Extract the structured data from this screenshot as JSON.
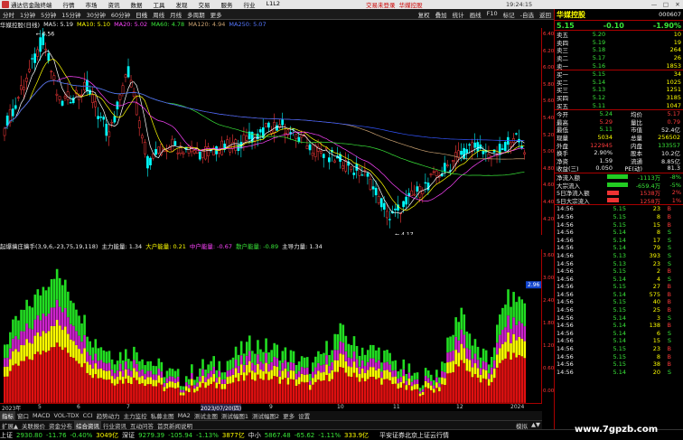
{
  "titlebar": {
    "app": "通达信金融终端",
    "menu": [
      "行情",
      "市场",
      "资讯",
      "数据",
      "工具",
      "发现",
      "交易",
      "服务",
      "行业",
      "L1L2"
    ],
    "promo_login": "交易未登录",
    "promo_stock": "华媒控股",
    "clock": "19:24:15",
    "winbtns": [
      "—",
      "□",
      "✕"
    ]
  },
  "toolbar": {
    "timeframes": [
      "分时",
      "1分钟",
      "5分钟",
      "15分钟",
      "30分钟",
      "60分钟",
      "日线",
      "周线",
      "月线",
      "多周期",
      "更多"
    ],
    "active": "日线",
    "right": [
      "复权",
      "叠加",
      "统计",
      "画线",
      "F10",
      "标记",
      "-自选",
      "返回"
    ]
  },
  "kline_head": {
    "name": "华媒控股(日线)",
    "ma5": "MA5: 5.19",
    "ma10": "MA10: 5.10",
    "ma20": "MA20: 5.02",
    "ma60": "MA60: 4.78",
    "ma120": "MA120: 4.94",
    "ma250": "MA250: 5.07"
  },
  "kline_labels": {
    "high": "6.56",
    "low": "4.17"
  },
  "ind_head": {
    "name": "起爆擒庄擒手(3,9,6,-23,75,19,118)",
    "main": "主力能量: 1.34",
    "large": "大户能量: 0.21",
    "mid": "中户能量: -0.67",
    "retail": "散户能量: -0.89",
    "main2": "主导力量: 1.34"
  },
  "ind_labels": {
    "current": "2.96",
    "lbl1": "散户",
    "lbl2": "中户",
    "lbl3": "大户",
    "lbl4": "主力"
  },
  "kline_yaxis": [
    "6.40",
    "6.20",
    "6.00",
    "5.80",
    "5.60",
    "5.40",
    "5.20",
    "5.00",
    "4.80",
    "4.60",
    "4.40",
    "4.20"
  ],
  "ind_yaxis": [
    "3.60",
    "3.00",
    "2.40",
    "1.80",
    "1.20",
    "0.60",
    "0.00"
  ],
  "xaxis": [
    "2023年",
    "5",
    "6",
    "7",
    "2023/07/20(四)",
    "9",
    "10",
    "11",
    "12",
    "2024"
  ],
  "ind_tabs": [
    "指标",
    "窗口",
    "MACD",
    "VOL-TDX",
    "CCI",
    "趋势动力",
    "主力监控",
    "私募主图",
    "MA2",
    "测试主图",
    "测试幅图1",
    "测试幅图2",
    "更多",
    "设置"
  ],
  "ind_tab_active": "指标",
  "bottom_tabs": [
    "扩展▲",
    "关联报价",
    "资金分布",
    "综合资讯",
    "行业资讯",
    "互动问答",
    "首页新闻说明"
  ],
  "bottom_right": [
    "模拟",
    "▲▼"
  ],
  "rp": {
    "name": "华媒控股",
    "code": "000607",
    "price": "5.15",
    "chg": "-0.10",
    "pct": "-1.90%",
    "asks": [
      [
        "卖五",
        "5.20",
        "10"
      ],
      [
        "卖四",
        "5.19",
        "19"
      ],
      [
        "卖三",
        "5.18",
        "264"
      ],
      [
        "卖二",
        "5.17",
        "26"
      ],
      [
        "卖一",
        "5.16",
        "1853"
      ]
    ],
    "bids": [
      [
        "买一",
        "5.15",
        "34"
      ],
      [
        "买二",
        "5.14",
        "1025"
      ],
      [
        "买三",
        "5.13",
        "1251"
      ],
      [
        "买四",
        "5.12",
        "3185"
      ],
      [
        "买五",
        "5.11",
        "1047"
      ]
    ],
    "stats": [
      [
        "今开",
        "5.24",
        "均价",
        "5.17"
      ],
      [
        "最高",
        "5.29",
        "量比",
        "0.79"
      ],
      [
        "最低",
        "5.11",
        "市值",
        "52.4亿"
      ],
      [
        "现量",
        "5034",
        "总量",
        "256502"
      ],
      [
        "外盘",
        "122945",
        "内盘",
        "133557"
      ],
      [
        "换手",
        "2.90%",
        "股本",
        "10.2亿"
      ],
      [
        "净资",
        "1.59",
        "流通",
        "8.85亿"
      ],
      [
        "收益(三)",
        "0.050",
        "PE(动)",
        "81.3"
      ]
    ],
    "flow": [
      [
        "净流入额",
        "-1113万",
        "-8%",
        "dn"
      ],
      [
        "大宗流入",
        "-659.4万",
        "-5%",
        "dn"
      ],
      [
        "5日净流入额",
        "1538万",
        "2%",
        "up"
      ],
      [
        "5日大宗流入",
        "1258万",
        "1%",
        "up"
      ]
    ],
    "trades": [
      [
        "14:56",
        "5.15",
        "23",
        "B"
      ],
      [
        "14:56",
        "5.15",
        "8",
        "B"
      ],
      [
        "14:56",
        "5.15",
        "15",
        "B"
      ],
      [
        "14:56",
        "5.14",
        "8",
        "S"
      ],
      [
        "14:56",
        "5.14",
        "17",
        "S"
      ],
      [
        "14:56",
        "5.14",
        "79",
        "S"
      ],
      [
        "14:56",
        "5.13",
        "393",
        "S"
      ],
      [
        "14:56",
        "5.13",
        "23",
        "S"
      ],
      [
        "14:56",
        "5.15",
        "2",
        "B"
      ],
      [
        "14:56",
        "5.14",
        "4",
        "S"
      ],
      [
        "14:56",
        "5.15",
        "27",
        "B"
      ],
      [
        "14:56",
        "5.14",
        "575",
        "B"
      ],
      [
        "14:56",
        "5.15",
        "40",
        "B"
      ],
      [
        "14:56",
        "5.15",
        "25",
        "B"
      ],
      [
        "14:56",
        "5.14",
        "3",
        "S"
      ],
      [
        "14:56",
        "5.14",
        "138",
        "B"
      ],
      [
        "14:56",
        "5.14",
        "6",
        "S"
      ],
      [
        "14:56",
        "5.14",
        "15",
        "S"
      ],
      [
        "14:56",
        "5.15",
        "23",
        "B"
      ],
      [
        "14:56",
        "5.15",
        "8",
        "B"
      ],
      [
        "14:56",
        "5.15",
        "38",
        "B"
      ],
      [
        "14:56",
        "5.14",
        "20",
        "S"
      ]
    ]
  },
  "ticker": [
    {
      "name": "上证",
      "val": "2930.80",
      "chg": "-11.76",
      "pct": "-0.40%",
      "amt": "3049亿"
    },
    {
      "name": "深证",
      "val": "9279.39",
      "chg": "-105.94",
      "pct": "-1.13%",
      "amt": "3877亿"
    },
    {
      "name": "中小",
      "val": "5867.48",
      "chg": "-65.62",
      "pct": "-1.11%",
      "amt": "333.9亿"
    }
  ],
  "ticker_tail": "平安证券北京上证云行情",
  "watermark": "www.7gpzb.com"
}
